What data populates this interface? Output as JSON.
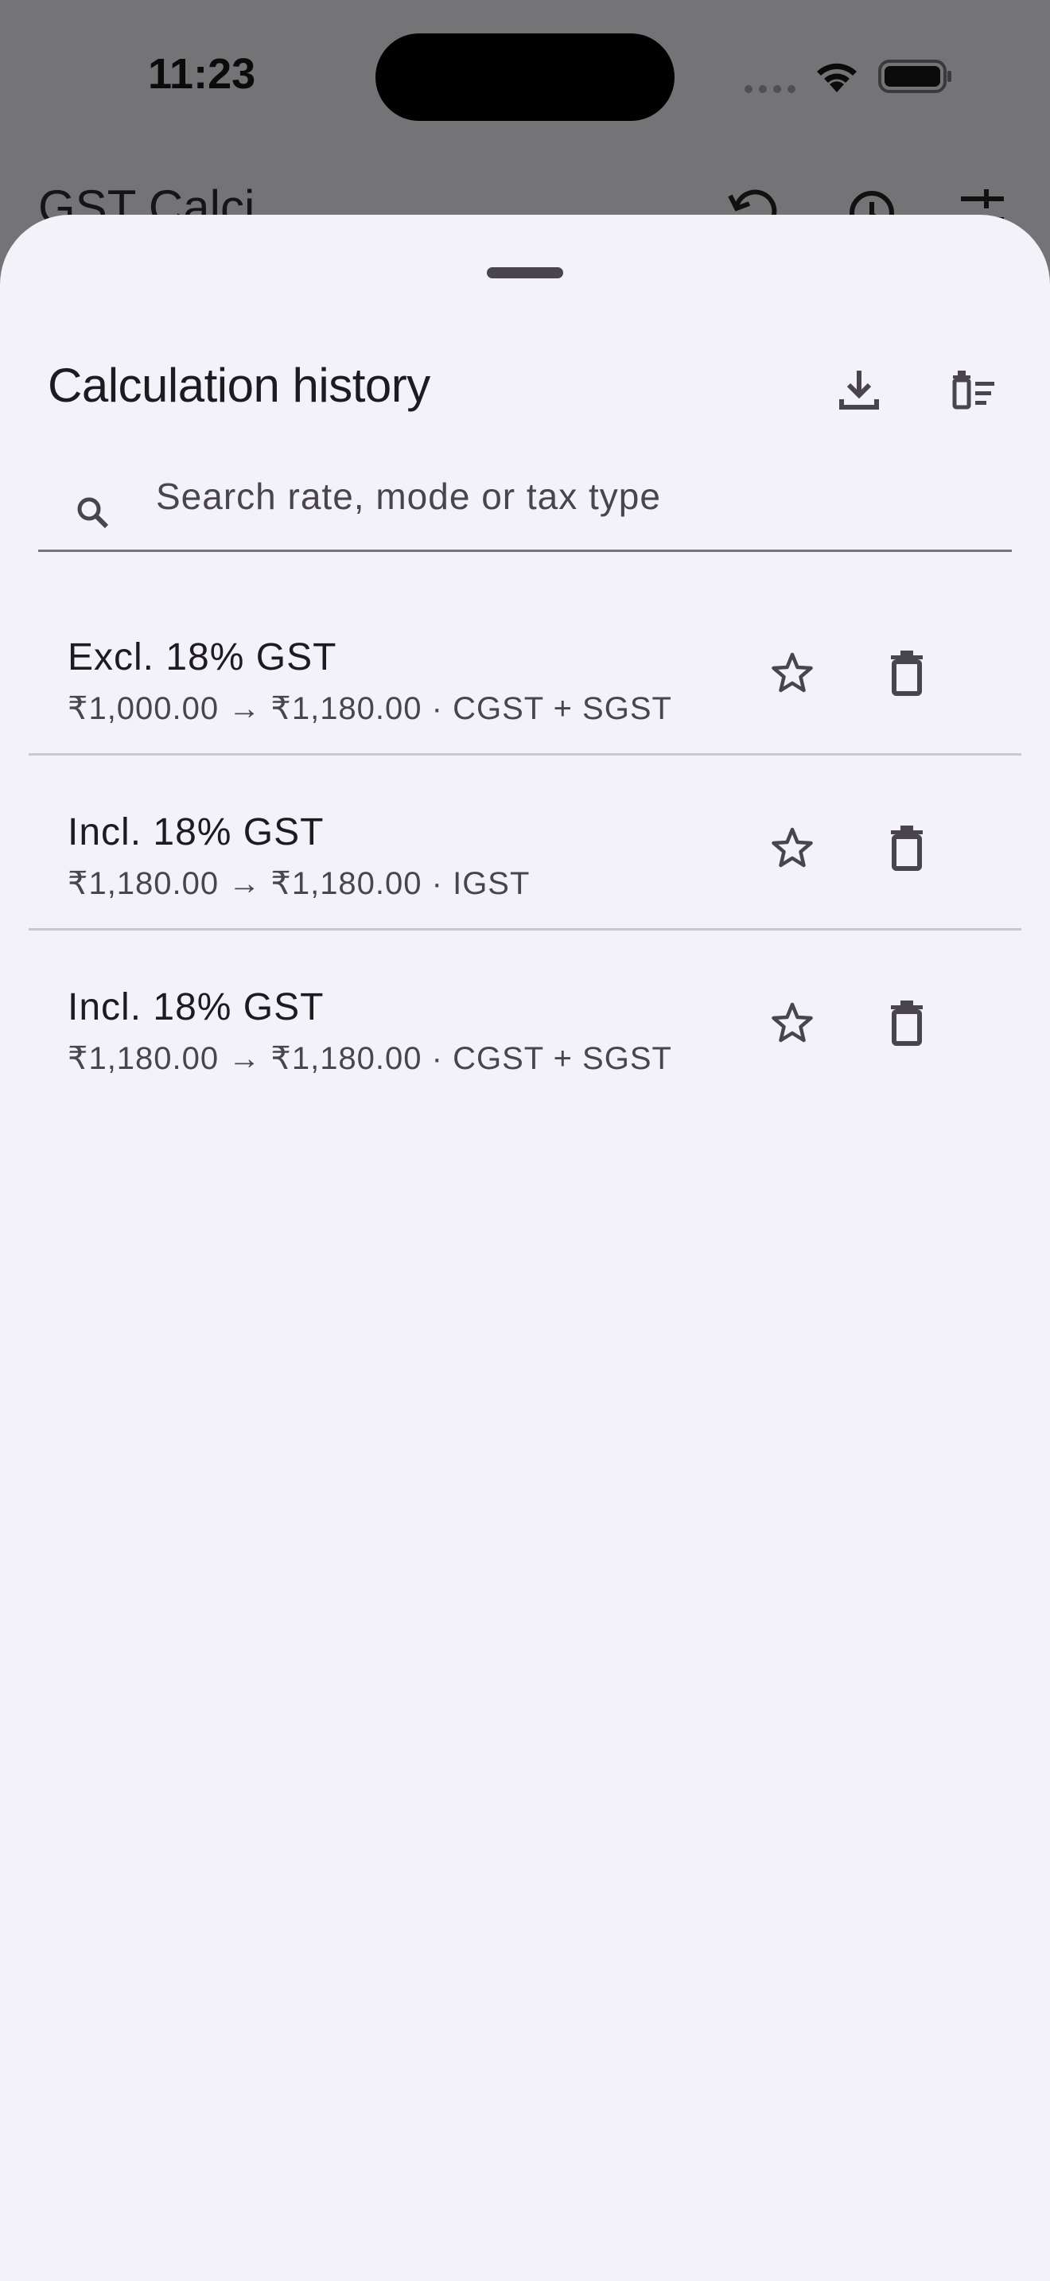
{
  "status_bar": {
    "time": "11:23"
  },
  "app_bar": {
    "title": "GST Calci",
    "icons": [
      "undo-icon",
      "history-icon",
      "tune-icon"
    ]
  },
  "sheet": {
    "title": "Calculation history",
    "actions": [
      "download-icon",
      "clear-all-icon"
    ],
    "search": {
      "placeholder": "Search rate, mode or tax type",
      "value": ""
    },
    "items": [
      {
        "title": "Excl. 18% GST",
        "subtitle": "₹1,000.00 → ₹1,180.00 · CGST + SGST"
      },
      {
        "title": "Incl. 18% GST",
        "subtitle": "₹1,180.00 → ₹1,180.00 · IGST"
      },
      {
        "title": "Incl. 18% GST",
        "subtitle": "₹1,180.00 → ₹1,180.00 · CGST + SGST"
      }
    ]
  },
  "colors": {
    "scrim": "#747375",
    "sheet_background": "#f4f2f9",
    "primary_text": "#1d1b20",
    "secondary_text": "#49454f",
    "divider": "#c9c6ce",
    "icon": "#49454f"
  }
}
